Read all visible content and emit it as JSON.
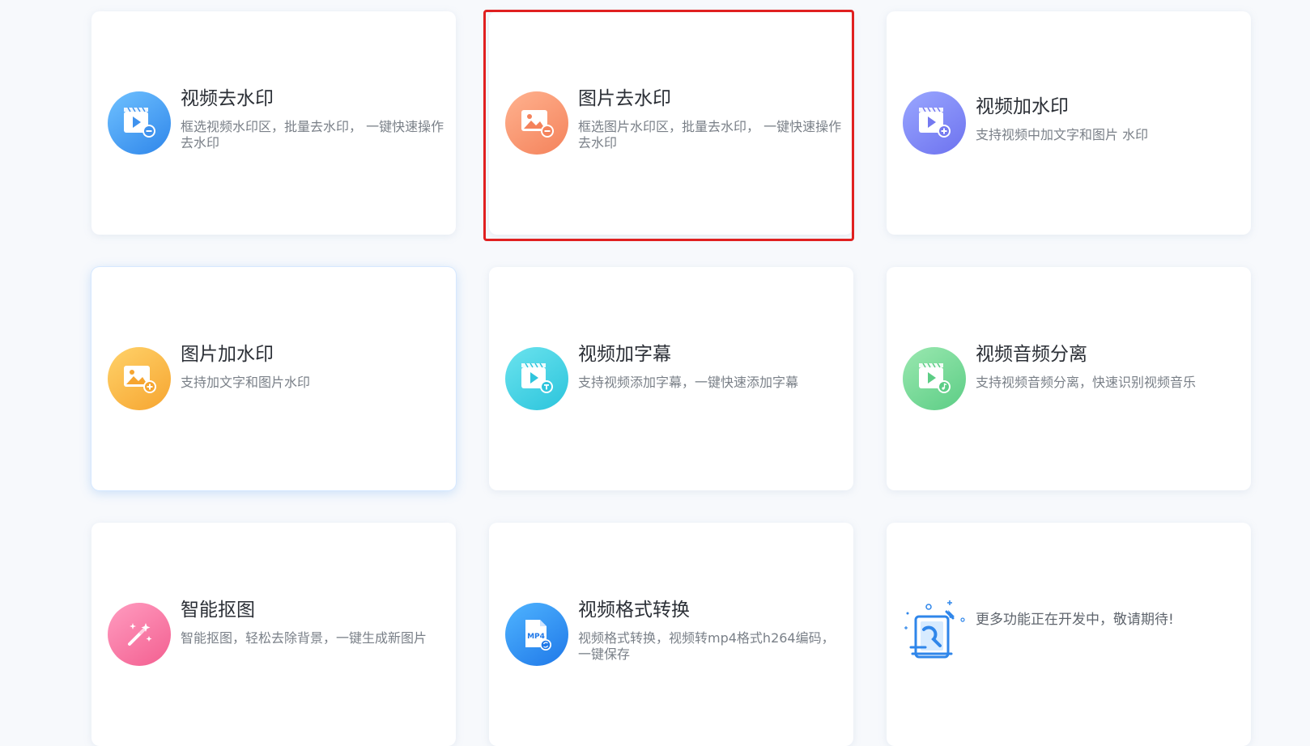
{
  "cards": [
    {
      "title": "视频去水印",
      "desc": "框选视频水印区，批量去水印， 一键快速操作去水印",
      "icon": "video-remove-watermark-icon",
      "color": "#2f86ea"
    },
    {
      "title": "图片去水印",
      "desc": "框选图片水印区，批量去水印， 一键快速操作去水印",
      "icon": "image-remove-watermark-icon",
      "color": "#f4825b"
    },
    {
      "title": "视频加水印",
      "desc": "支持视频中加文字和图片 水印",
      "icon": "video-add-watermark-icon",
      "color": "#6d72ef"
    },
    {
      "title": "图片加水印",
      "desc": "支持加文字和图片水印",
      "icon": "image-add-watermark-icon",
      "color": "#f6a530"
    },
    {
      "title": "视频加字幕",
      "desc": "支持视频添加字幕，一键快速添加字幕",
      "icon": "video-add-subtitle-icon",
      "color": "#2bc4dc"
    },
    {
      "title": "视频音频分离",
      "desc": "支持视频音频分离，快速识别视频音乐",
      "icon": "video-audio-separate-icon",
      "color": "#5ccd85"
    },
    {
      "title": "智能抠图",
      "desc": "智能抠图，轻松去除背景，一键生成新图片",
      "icon": "magic-wand-icon",
      "color": "#f35f90"
    },
    {
      "title": "视频格式转换",
      "desc": "视频格式转换，视频转mp4格式h264编码，一键保存",
      "icon": "mp4-file-icon",
      "icon_label": "MP4",
      "color": "#1f78e8"
    },
    {
      "title": "",
      "desc": "更多功能正在开发中，敬请期待!",
      "icon": "developing-tablet-icon",
      "color": "#2f86ea"
    }
  ],
  "highlight_color": "#e02020"
}
